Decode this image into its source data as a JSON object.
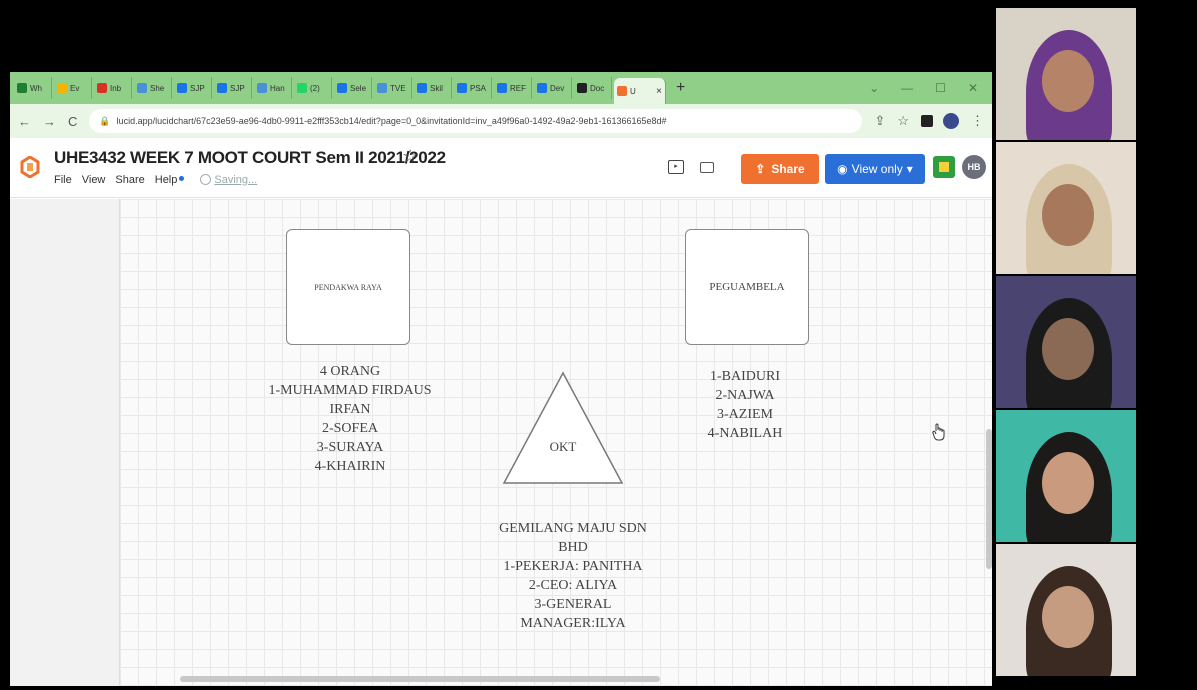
{
  "browser": {
    "tabs": [
      {
        "label": "Wh",
        "color": "#1e7e34"
      },
      {
        "label": "Ev",
        "color": "#f4b400"
      },
      {
        "label": "Inb",
        "color": "#d93025"
      },
      {
        "label": "She",
        "color": "#4a90d9"
      },
      {
        "label": "SJP",
        "color": "#1a73e8"
      },
      {
        "label": "SJP",
        "color": "#1a73e8"
      },
      {
        "label": "Han",
        "color": "#4a90d9"
      },
      {
        "label": "(2)",
        "color": "#25d366"
      },
      {
        "label": "Sele",
        "color": "#1a73e8"
      },
      {
        "label": "TVE",
        "color": "#4a90d9"
      },
      {
        "label": "Skil",
        "color": "#1a73e8"
      },
      {
        "label": "PSA",
        "color": "#1a73e8"
      },
      {
        "label": "REF",
        "color": "#1a73e8"
      },
      {
        "label": "Dev",
        "color": "#1a73e8"
      },
      {
        "label": "Doc",
        "color": "#202124"
      }
    ],
    "active_tab": {
      "label": "U",
      "color": "#f07030"
    },
    "new_tab": "+",
    "url": "lucid.app/lucidchart/67c23e59-ae96-4db0-9911-e2fff353cb14/edit?page=0_0&invitationId=inv_a49f96a0-1492-49a2-9eb1-161366165e8d#"
  },
  "app": {
    "title": "UHE3432 WEEK 7 MOOT COURT Sem II 2021/2022",
    "menu": [
      "File",
      "View",
      "Share",
      "Help"
    ],
    "saving": "Saving...",
    "share_label": "Share",
    "view_only_label": "View only",
    "avatar_initials": "HB"
  },
  "diagram": {
    "pendakwa_box": "PENDAKWA RAYA",
    "peguambela_box": "PEGUAMBELA",
    "okt_label": "OKT",
    "pendakwa_lines": [
      "4 ORANG",
      "1-MUHAMMAD FIRDAUS",
      "IRFAN",
      "2-SOFEA",
      "3-SURAYA",
      "4-KHAIRIN"
    ],
    "peguambela_lines": [
      "1-BAIDURI",
      "2-NAJWA",
      "3-AZIEM",
      "4-NABILAH"
    ],
    "gemilang_lines": [
      "GEMILANG MAJU SDN",
      "BHD",
      "1-PEKERJA: PANITHA",
      "2-CEO: ALIYA",
      "3-GENERAL",
      "MANAGER:ILYA"
    ]
  },
  "participants": [
    {
      "bg": "#d9d2c6",
      "hijab": "#6b3a8a",
      "skin": "#b58468"
    },
    {
      "bg": "#e6dccf",
      "hijab": "#d8c6a8",
      "skin": "#a8785c"
    },
    {
      "bg": "#4a4470",
      "hijab": "#1a1a1a",
      "skin": "#8a6a55"
    },
    {
      "bg": "#3fb8a5",
      "hijab": "#1c1a18",
      "skin": "#c99a7e"
    },
    {
      "bg": "#e2ddd8",
      "hijab": "#3a2a22",
      "skin": "#c69c80"
    }
  ]
}
